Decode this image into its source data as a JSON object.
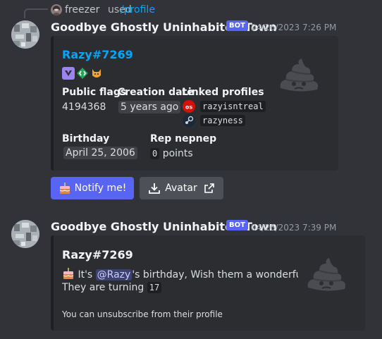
{
  "reply": {
    "user": "freezer",
    "used": "used",
    "command": "/profile"
  },
  "message1": {
    "author": "Goodbye Ghostly Uninhabited Town",
    "badge": "BOT",
    "timestamp": "04/26/2023 7:26 PM",
    "embed": {
      "title": "Razy#7269",
      "fields": {
        "public_flags": {
          "name": "Public flags",
          "value": "4194368"
        },
        "creation_date": {
          "name": "Creation date",
          "value": "5 years ago"
        },
        "linked_profiles": {
          "name": "Linked profiles",
          "lastfm": "razyisntreal",
          "steam": "razyness"
        },
        "birthday": {
          "name": "Birthday",
          "value": "April 25, 2006"
        },
        "rep": {
          "name": "Rep nepnep",
          "count": "0",
          "unit": "points"
        }
      }
    },
    "buttons": {
      "notify": "Notify me!",
      "avatar": "Avatar"
    }
  },
  "message2": {
    "author": "Goodbye Ghostly Uninhabited Town",
    "badge": "BOT",
    "timestamp": "04/26/2023 7:39 PM",
    "embed": {
      "title": "Razy#7269",
      "line1_prefix": "It's ",
      "mention": "@Razy",
      "line1_suffix": "'s birthday, Wish them a wonderful day!",
      "line2_prefix": "They are turning",
      "age": "17",
      "footer": "You can unsubscribe from their profile"
    }
  },
  "colors": {
    "background": "#313338",
    "embed": "#2b2d31",
    "blurple": "#5865f2",
    "link": "#00a8fc"
  },
  "icons": [
    "cake-icon",
    "download-icon",
    "external-link-icon",
    "lastfm-icon",
    "steam-icon",
    "hypesquad-badge-icon",
    "active-developer-badge-icon",
    "cat-badge-icon",
    "poop-icon"
  ]
}
